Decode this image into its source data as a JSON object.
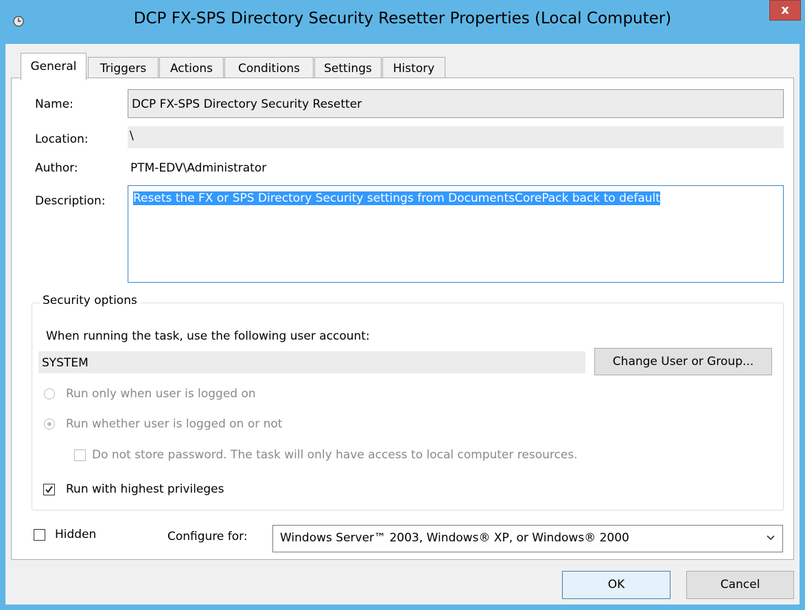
{
  "window": {
    "title": "DCP FX-SPS Directory Security Resetter Properties (Local Computer)",
    "close_label": "x"
  },
  "tabs": [
    {
      "label": "General",
      "active": true
    },
    {
      "label": "Triggers"
    },
    {
      "label": "Actions"
    },
    {
      "label": "Conditions"
    },
    {
      "label": "Settings"
    },
    {
      "label": "History"
    }
  ],
  "general": {
    "name_label": "Name:",
    "name_value": "DCP FX-SPS Directory Security Resetter",
    "location_label": "Location:",
    "location_value": "\\",
    "author_label": "Author:",
    "author_value": "PTM-EDV\\Administrator",
    "description_label": "Description:",
    "description_value": "Resets the FX or SPS Directory Security settings from DocumentsCorePack back to default"
  },
  "security": {
    "legend": "Security options",
    "account_prompt": "When running the task, use the following user account:",
    "account_value": "SYSTEM",
    "change_user_button": "Change User or Group...",
    "radio_logged_on": "Run only when user is logged on",
    "radio_whether": "Run whether user is logged on or not",
    "no_store_password": "Do not store password.  The task will only have access to local computer resources.",
    "highest_privileges": "Run with highest privileges",
    "highest_privileges_checked": true
  },
  "footer": {
    "hidden_label": "Hidden",
    "hidden_checked": false,
    "configure_label": "Configure for:",
    "configure_value": "Windows Server™ 2003, Windows® XP, or Windows® 2000",
    "ok_button": "OK",
    "cancel_button": "Cancel"
  },
  "colors": {
    "titlebar": "#5fb6e6",
    "close": "#c7504a",
    "selection": "#3399ff"
  }
}
